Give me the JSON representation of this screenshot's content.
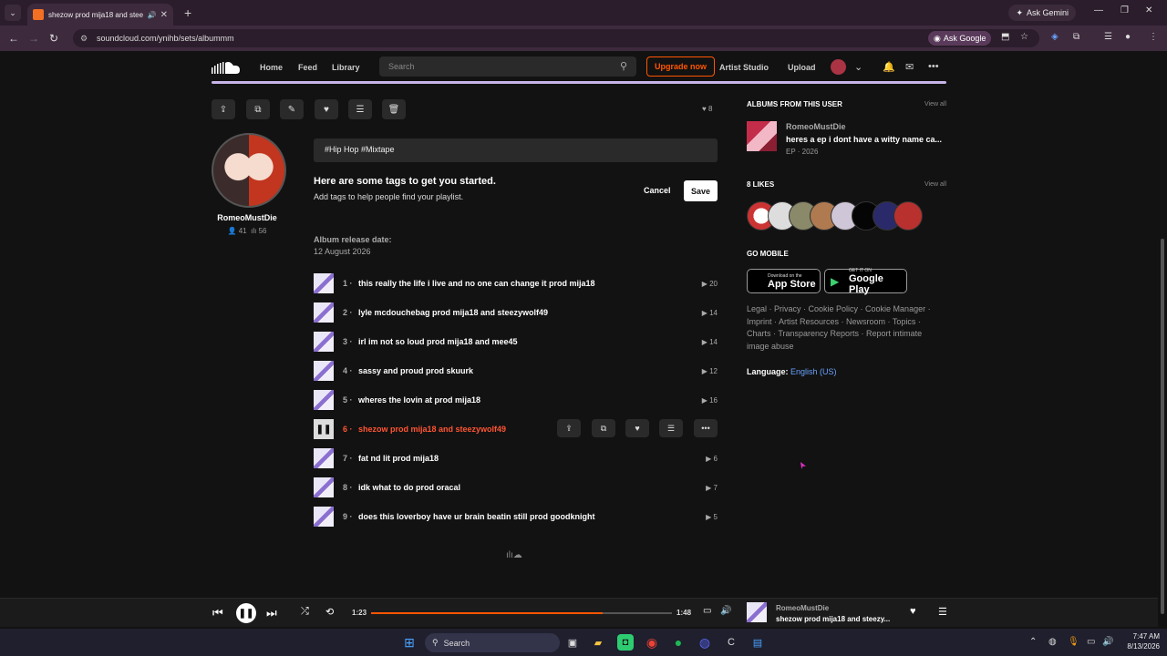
{
  "browser": {
    "tab_title": "shezow prod mija18 and stee",
    "url": "soundcloud.com/ynihb/sets/albummm",
    "ask_gemini": "Ask Gemini",
    "ask_google": "Ask Google"
  },
  "header": {
    "nav": [
      "Home",
      "Feed",
      "Library"
    ],
    "search_placeholder": "Search",
    "upgrade": "Upgrade now",
    "artist_studio": "Artist Studio",
    "upload": "Upload"
  },
  "playlist": {
    "likes": "8",
    "artist": "RomeoMustDie",
    "followers": "41",
    "following": "56",
    "tags": "#Hip Hop  #Mixtape",
    "tag_prompt_title": "Here are some tags to get you started.",
    "tag_prompt_sub": "Add tags to help people find your playlist.",
    "cancel": "Cancel",
    "save": "Save",
    "release_label": "Album release date:",
    "release_date": "12 August 2026",
    "tracks": [
      {
        "num": "1",
        "title": "this really the life i live and no one can change it prod mija18",
        "plays": "20"
      },
      {
        "num": "2",
        "title": "lyle mcdouchebag prod mija18 and steezywolf49",
        "plays": "14"
      },
      {
        "num": "3",
        "title": "irl im not so loud prod mija18 and mee45",
        "plays": "14"
      },
      {
        "num": "4",
        "title": "sassy and proud prod skuurk",
        "plays": "12"
      },
      {
        "num": "5",
        "title": "wheres the lovin at prod mija18",
        "plays": "16"
      },
      {
        "num": "6",
        "title": "shezow prod mija18 and steezywolf49",
        "plays": ""
      },
      {
        "num": "7",
        "title": "fat nd lit prod mija18",
        "plays": "6"
      },
      {
        "num": "8",
        "title": "idk what to do prod oracal",
        "plays": "7"
      },
      {
        "num": "9",
        "title": "does this loverboy have ur brain beatin still prod goodknight",
        "plays": "5"
      }
    ]
  },
  "sidebar": {
    "albums_head": "ALBUMS FROM THIS USER",
    "view_all": "View all",
    "album_user": "RomeoMustDie",
    "album_title": "heres a ep i dont have a witty name ca...",
    "album_meta": "EP · 2026",
    "likes_head": "8 LIKES",
    "mobile_head": "GO MOBILE",
    "appstore_small": "Download on the",
    "appstore_big": "App Store",
    "gplay_small": "GET IT ON",
    "gplay_big": "Google Play",
    "legal": "Legal · Privacy · Cookie Policy · Cookie Manager · Imprint · Artist Resources · Newsroom · Topics · Charts · Transparency Reports · Report intimate image abuse",
    "language_label": "Language:",
    "language_value": "English (US)"
  },
  "player": {
    "elapsed": "1:23",
    "duration": "1:48",
    "progress": 0.77,
    "artist": "RomeoMustDie",
    "track": "shezow prod mija18 and steezy..."
  },
  "taskbar": {
    "search": "Search",
    "time": "7:47 AM",
    "date": "8/13/2026"
  }
}
